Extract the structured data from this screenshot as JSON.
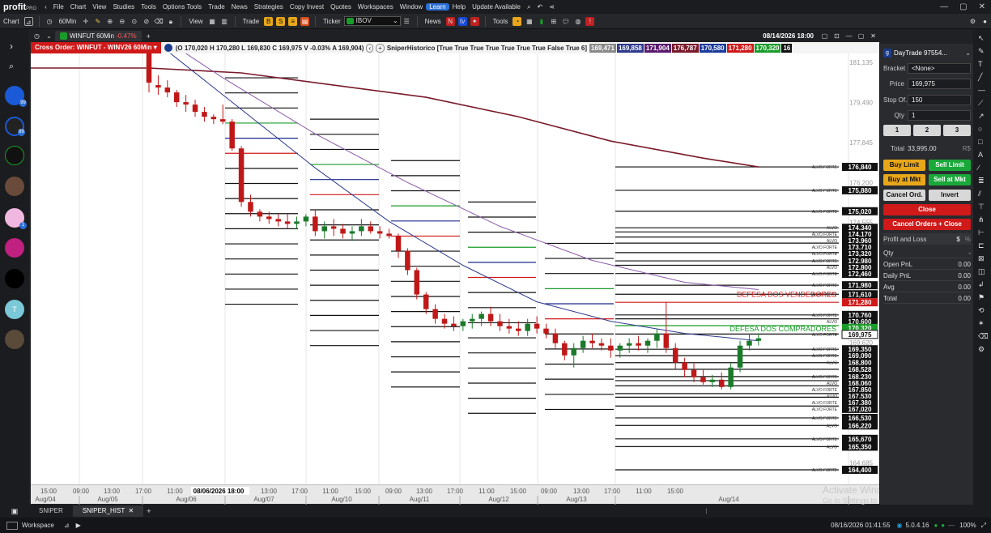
{
  "app": {
    "brand": "profit",
    "brand_suffix": "PRO",
    "menu": [
      "File",
      "Chart",
      "View",
      "Studies",
      "Tools",
      "Options Tools",
      "Trade",
      "News",
      "Strategies",
      "Copy Invest",
      "Quotes",
      "Workspaces",
      "Window",
      "Learn",
      "Help",
      "Update Available"
    ]
  },
  "toolbar": {
    "chart_label": "Chart",
    "interval": "60Min",
    "view_label": "View",
    "trade_label": "Trade",
    "ticker_label": "Ticker",
    "ticker_value": "IBOV",
    "news_label": "News",
    "tools_label": "Tools"
  },
  "chart_tab": {
    "symbol": "WINFUT 60Min",
    "change": "-0.47%",
    "datetime": "08/14/2026 18:00",
    "add": "+"
  },
  "chart_info": {
    "cross_order": "Cross Order: WINFUT - WINV26 60Min",
    "ohlc": "(O 170,020 H 170,280 L 169,830 C 169,975 V -0.03% A 169,904)",
    "indicator": "SniperHistorico [True True True True True True True False True 6]",
    "ind_values": [
      {
        "v": "169,471",
        "c": "#8a8a8a"
      },
      {
        "v": "169,858",
        "c": "#2e3a8c"
      },
      {
        "v": "171,904",
        "c": "#5a1a6e"
      },
      {
        "v": "176,787",
        "c": "#7a1a2a"
      },
      {
        "v": "170,580",
        "c": "#1a3a9c"
      },
      {
        "v": "171,280",
        "c": "#d01919"
      },
      {
        "v": "170,320",
        "c": "#1a9c2a"
      },
      {
        "v": "16",
        "c": "#111111"
      }
    ]
  },
  "chart_data": {
    "type": "candlestick",
    "ylim": [
      163800,
      181500
    ],
    "y_ticks": [
      "181,135",
      "179,490",
      "177,845",
      "176,200",
      "174,555",
      "172,910",
      "171,265",
      "169,620",
      "167,975",
      "166,330",
      "164,685"
    ],
    "x_ticks": [
      "15:00",
      "09:00",
      "13:00",
      "17:00",
      "11:00",
      "08/06/2026 18:00",
      "13:00",
      "17:00",
      "11:00",
      "15:00",
      "09:00",
      "13:00",
      "17:00",
      "11:00",
      "15:00",
      "09:00",
      "13:00",
      "17:00",
      "11:00",
      "15:00"
    ],
    "date_ticks": [
      "Aug/04",
      "Aug/05",
      "Aug/06",
      "Aug/07",
      "Aug/10",
      "Aug/11",
      "Aug/12",
      "Aug/13",
      "Aug/14"
    ],
    "candles": [
      [
        181800,
        182000,
        179900,
        180300
      ],
      [
        180200,
        180600,
        179800,
        180100
      ],
      [
        180100,
        180400,
        179700,
        179900
      ],
      [
        179900,
        180000,
        179300,
        179500
      ],
      [
        179500,
        179800,
        179100,
        179400
      ],
      [
        179400,
        179600,
        178900,
        179100
      ],
      [
        179100,
        179300,
        178700,
        178900
      ],
      [
        178900,
        179000,
        178600,
        178800
      ],
      [
        178800,
        179400,
        178600,
        178700
      ],
      [
        178700,
        178800,
        177500,
        177600
      ],
      [
        177600,
        177700,
        175200,
        175400
      ],
      [
        175400,
        175700,
        174800,
        175000
      ],
      [
        175000,
        175100,
        174600,
        174800
      ],
      [
        174800,
        175000,
        174500,
        174700
      ],
      [
        174700,
        174900,
        174400,
        174600
      ],
      [
        174600,
        174900,
        174300,
        174500
      ],
      [
        174500,
        174800,
        174300,
        174600
      ],
      [
        174600,
        174900,
        174400,
        174800
      ],
      [
        174800,
        175100,
        174000,
        174200
      ],
      [
        174200,
        174600,
        173900,
        174400
      ],
      [
        174400,
        174700,
        174000,
        174300
      ],
      [
        174300,
        174500,
        173900,
        174100
      ],
      [
        174100,
        174400,
        173800,
        174200
      ],
      [
        174200,
        174700,
        174000,
        174400
      ],
      [
        174400,
        174600,
        174100,
        174200
      ],
      [
        174200,
        174400,
        173900,
        174100
      ],
      [
        174100,
        174300,
        173900,
        174000
      ],
      [
        174000,
        174100,
        173100,
        173400
      ],
      [
        173400,
        173500,
        172400,
        172600
      ],
      [
        172600,
        172700,
        171400,
        171600
      ],
      [
        171600,
        171700,
        170800,
        171000
      ],
      [
        171000,
        171200,
        170400,
        170600
      ],
      [
        170600,
        170800,
        170200,
        170400
      ],
      [
        170400,
        170700,
        170100,
        170300
      ],
      [
        170300,
        170600,
        170100,
        170500
      ],
      [
        170500,
        170800,
        170200,
        170600
      ],
      [
        170600,
        170900,
        170300,
        170800
      ],
      [
        170800,
        171100,
        170300,
        170500
      ],
      [
        170500,
        170800,
        170100,
        170300
      ],
      [
        170300,
        170600,
        170000,
        170200
      ],
      [
        170200,
        170500,
        169900,
        170100
      ],
      [
        170100,
        170600,
        169900,
        170400
      ],
      [
        170400,
        170700,
        170000,
        170200
      ],
      [
        170200,
        170400,
        169800,
        170000
      ],
      [
        170000,
        170200,
        169400,
        169600
      ],
      [
        169600,
        169700,
        168900,
        169100
      ],
      [
        169100,
        169600,
        168600,
        169400
      ],
      [
        169400,
        169900,
        169200,
        169700
      ],
      [
        169700,
        170000,
        169400,
        169600
      ],
      [
        169600,
        169800,
        169300,
        169500
      ],
      [
        169500,
        169800,
        169000,
        169300
      ],
      [
        169300,
        169600,
        169000,
        169500
      ],
      [
        169500,
        169800,
        169200,
        169600
      ],
      [
        169600,
        169900,
        169300,
        169500
      ],
      [
        169500,
        169800,
        169200,
        169700
      ],
      [
        169700,
        170200,
        169400,
        170000
      ],
      [
        170000,
        171300,
        169200,
        169400
      ],
      [
        169400,
        169600,
        168500,
        168800
      ],
      [
        168800,
        169000,
        168200,
        168500
      ],
      [
        168500,
        168800,
        168000,
        168200
      ],
      [
        168200,
        168500,
        167900,
        168000
      ],
      [
        168000,
        168300,
        167800,
        168100
      ],
      [
        168100,
        168400,
        167700,
        167800
      ],
      [
        167800,
        168800,
        167700,
        168600
      ],
      [
        168600,
        169700,
        168400,
        169500
      ],
      [
        169500,
        170000,
        169300,
        169700
      ],
      [
        169700,
        170000,
        169500,
        169800
      ]
    ],
    "sessions": [
      "Aug/04",
      "Aug/05",
      "Aug/06",
      "Aug/07",
      "Aug/10",
      "Aug/11",
      "Aug/12",
      "Aug/13",
      "Aug/14"
    ],
    "price_labels": [
      {
        "value": 176840,
        "text": "176,840",
        "tag": "ALVO FORTE"
      },
      {
        "value": 175880,
        "text": "175,880",
        "tag": "ALVO FORTE"
      },
      {
        "value": 175020,
        "text": "175,020",
        "tag": "ALVO FORTE"
      },
      {
        "value": 174340,
        "text": "174,340",
        "tag": "ALVO"
      },
      {
        "value": 174170,
        "text": "174,170",
        "tag": "ALVO FORTE"
      },
      {
        "value": 173960,
        "text": "173,960",
        "tag": "ALVO"
      },
      {
        "value": 173710,
        "text": "173,710",
        "tag": "ALVO FORTE"
      },
      {
        "value": 173320,
        "text": "173,320",
        "tag": "ALVO FORTE"
      },
      {
        "value": 172980,
        "text": "172,980",
        "tag": "ALVO FORTE"
      },
      {
        "value": 172800,
        "text": "172,800",
        "tag": "ALVO"
      },
      {
        "value": 172460,
        "text": "172,460",
        "tag": "ALVO FORTE"
      },
      {
        "value": 171980,
        "text": "171,980",
        "tag": "ALVO FORTE"
      },
      {
        "value": 171610,
        "text": "171,610",
        "tag": "ALVO FORTE"
      },
      {
        "value": 171280,
        "text": "171,280",
        "tag": ""
      },
      {
        "value": 170760,
        "text": "170,760",
        "tag": "ALVO FORTE"
      },
      {
        "value": 170600,
        "text": "170,600",
        "tag": "ALVO"
      },
      {
        "value": 170320,
        "text": "170,320",
        "tag": ""
      },
      {
        "value": 169975,
        "text": "169,975",
        "tag": "ALVO FORTE"
      },
      {
        "value": 169350,
        "text": "169,350",
        "tag": "ALVO FORTE"
      },
      {
        "value": 169090,
        "text": "169,090",
        "tag": "ALVO FORTE"
      },
      {
        "value": 168800,
        "text": "168,800",
        "tag": "ALVO"
      },
      {
        "value": 168528,
        "text": "168,528",
        "tag": ""
      },
      {
        "value": 168230,
        "text": "168,230",
        "tag": "ALVO FORTE"
      },
      {
        "value": 168060,
        "text": "168,060",
        "tag": "ALVO"
      },
      {
        "value": 167850,
        "text": "167,850",
        "tag": "ALVO FORTE"
      },
      {
        "value": 167530,
        "text": "167,530",
        "tag": "ALVO"
      },
      {
        "value": 167380,
        "text": "167,380",
        "tag": "ALVO FORTE"
      },
      {
        "value": 167020,
        "text": "167,020",
        "tag": "ALVO FORTE"
      },
      {
        "value": 166530,
        "text": "166,530",
        "tag": "ALVO FORTE"
      },
      {
        "value": 166220,
        "text": "166,220",
        "tag": "ALVO"
      },
      {
        "value": 165670,
        "text": "165,670",
        "tag": "ALVO FORTE"
      },
      {
        "value": 165350,
        "text": "165,350",
        "tag": "ALVO"
      },
      {
        "value": 164400,
        "text": "164,400",
        "tag": "ALVO FORTE"
      }
    ],
    "annotations": [
      "DEFESA DOS VENDEDORES",
      "DEFESA DOS COMPRADORES"
    ],
    "ma_long": [
      [
        0,
        180900
      ],
      [
        10,
        180700
      ],
      [
        20,
        180200
      ],
      [
        30,
        179700
      ],
      [
        40,
        178900
      ],
      [
        50,
        177900
      ],
      [
        60,
        177200
      ],
      [
        66,
        176840
      ]
    ],
    "ma_mid": [
      [
        0,
        182500
      ],
      [
        8,
        180500
      ],
      [
        18,
        178200
      ],
      [
        28,
        176200
      ],
      [
        38,
        174400
      ],
      [
        48,
        173000
      ],
      [
        58,
        172100
      ],
      [
        66,
        171800
      ]
    ],
    "ma_short": [
      [
        0,
        182200
      ],
      [
        8,
        179800
      ],
      [
        18,
        176800
      ],
      [
        26,
        174600
      ],
      [
        34,
        172800
      ],
      [
        42,
        171300
      ],
      [
        50,
        170500
      ],
      [
        58,
        170000
      ],
      [
        66,
        169700
      ]
    ]
  },
  "panel": {
    "account": "DayTrade 97554...",
    "bracket_label": "Bracket",
    "bracket_value": "<None>",
    "price_label": "Price",
    "price_value": "169,975",
    "stop_label": "Stop Of.",
    "stop_value": "150",
    "qty_label": "Qty",
    "qty_value": "1",
    "presets": [
      "1",
      "2",
      "3"
    ],
    "total_label": "Total",
    "total_value": "33,995.00",
    "currency": "R$",
    "buy_limit": "Buy Limit",
    "sell_limit": "Sell Limit",
    "buy_mkt": "Buy at Mkt",
    "sell_mkt": "Sell at Mkt",
    "cancel_ord": "Cancel Ord.",
    "invert": "Invert",
    "close": "Close",
    "cancel_close": "Cancel Orders + Close",
    "pnl_title": "Profit and Loss",
    "pnl_rows": [
      {
        "k": "Qty",
        "v": "-"
      },
      {
        "k": "Open PnL",
        "v": "0.00"
      },
      {
        "k": "Daily PnL",
        "v": "0.00"
      },
      {
        "k": "Avg",
        "v": "0.00"
      },
      {
        "k": "Total",
        "v": "0.00"
      }
    ]
  },
  "bottom_tabs": [
    "SNIPER",
    "SNIPER_HIST"
  ],
  "status": {
    "workspace": "Workspace",
    "datetime": "08/16/2026 01:41:55",
    "version": "5.0.4.16",
    "zoom": "100%"
  },
  "watermark": {
    "line1": "Activate Windows",
    "line2": "Go to Settings to activate Windows."
  }
}
